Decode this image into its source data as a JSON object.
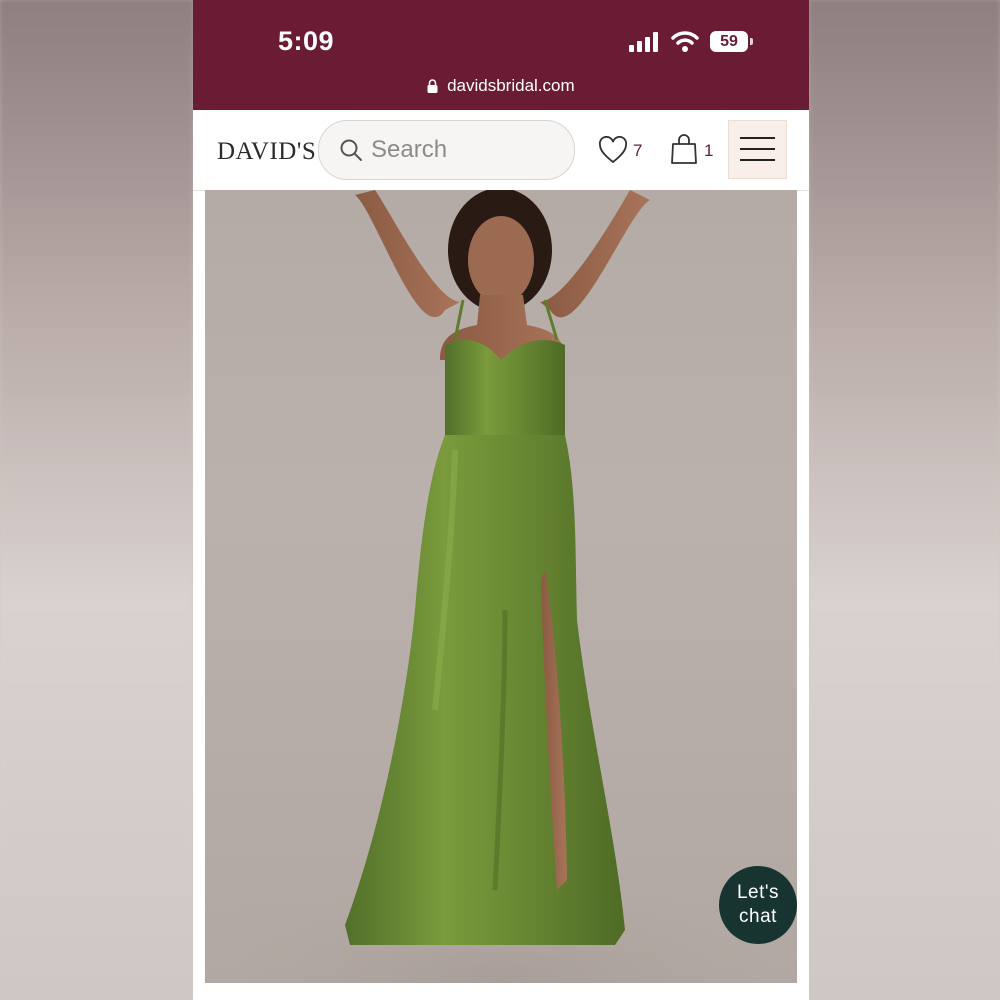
{
  "status_bar": {
    "time": "5:09",
    "battery": "59",
    "url": "davidsbridal.com"
  },
  "header": {
    "logo": "DAVID'S",
    "search_placeholder": "Search",
    "wishlist_count": "7",
    "bag_count": "1"
  },
  "product": {
    "dress_color": "#6b8a34"
  },
  "chat": {
    "line1": "Let's",
    "line2": "chat"
  },
  "colors": {
    "brand": "#6b1c35",
    "chat_bg": "#173430"
  }
}
